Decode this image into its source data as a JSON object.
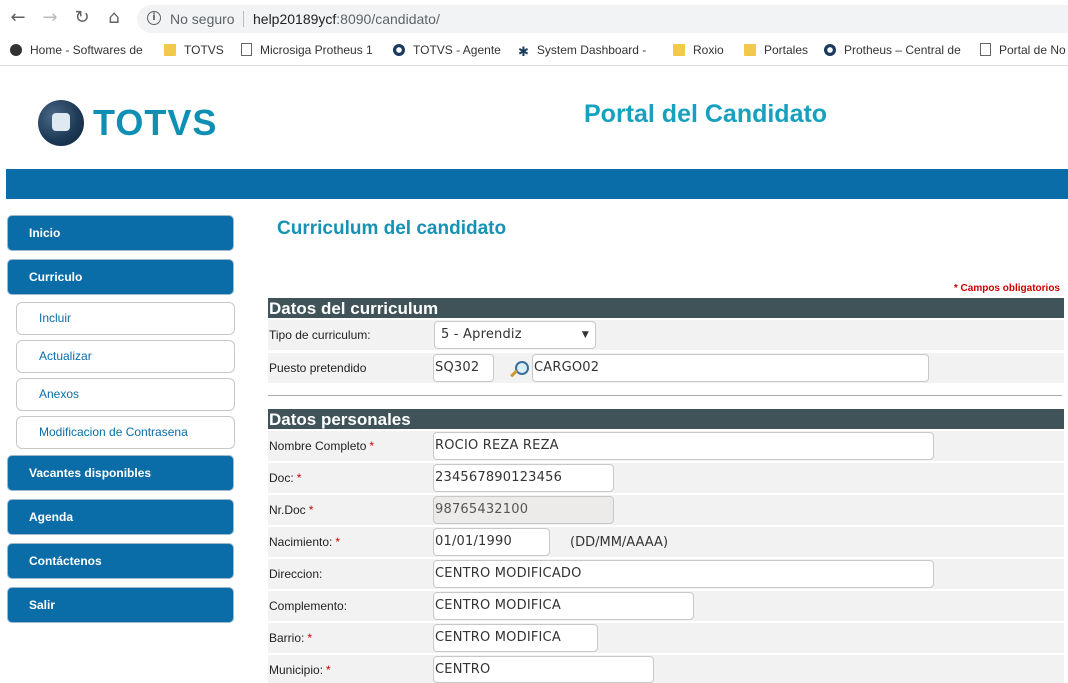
{
  "browser": {
    "security_label": "No seguro",
    "url_host": "help20189ycf",
    "url_rest": ":8090/candidato/",
    "bookmarks": [
      {
        "label": "Home - Softwares de",
        "icon": "globe-icon"
      },
      {
        "label": "TOTVS",
        "icon": "folder-icon"
      },
      {
        "label": "Microsiga Protheus 1",
        "icon": "page-icon"
      },
      {
        "label": "TOTVS - Agente",
        "icon": "totvs-icon"
      },
      {
        "label": "System Dashboard -",
        "icon": "jira-icon"
      },
      {
        "label": "Roxio",
        "icon": "folder-icon"
      },
      {
        "label": "Portales",
        "icon": "folder-icon"
      },
      {
        "label": "Protheus – Central de",
        "icon": "totvs-icon"
      },
      {
        "label": "Portal de No",
        "icon": "page-icon"
      }
    ]
  },
  "header": {
    "logo_text": "TOTVS",
    "portal_title": "Portal del Candidato"
  },
  "sidebar": {
    "items": [
      {
        "label": "Inicio"
      },
      {
        "label": "Curriculo"
      },
      {
        "label": "Incluir"
      },
      {
        "label": "Actualizar"
      },
      {
        "label": "Anexos"
      },
      {
        "label": "Modificacion de Contrasena"
      },
      {
        "label": "Vacantes disponibles"
      },
      {
        "label": "Agenda"
      },
      {
        "label": "Contáctenos"
      },
      {
        "label": "Salir"
      }
    ]
  },
  "main": {
    "title": "Curriculum del candidato",
    "required_note": "* Campos obligatorios",
    "section_curriculum": "Datos del curriculum",
    "section_personal": "Datos personales",
    "fields": {
      "tipo_label": "Tipo de curriculum:",
      "tipo_value": "5 - Aprendiz",
      "puesto_label": "Puesto pretendido",
      "puesto_code": "SQ302",
      "puesto_desc": "CARGO02",
      "nombre_label": "Nombre Completo",
      "nombre_value": "ROCIO REZA REZA",
      "doc_label": "Doc:",
      "doc_value": "234567890123456",
      "nrdoc_label": "Nr.Doc",
      "nrdoc_value": "98765432100",
      "nacimiento_label": "Nacimiento:",
      "nacimiento_value": "01/01/1990",
      "nacimiento_hint": "(DD/MM/AAAA)",
      "direccion_label": "Direccion:",
      "direccion_value": "CENTRO MODIFICADO",
      "complemento_label": "Complemento:",
      "complemento_value": "CENTRO MODIFICA",
      "barrio_label": "Barrio:",
      "barrio_value": "CENTRO MODIFICA",
      "municipio_label": "Municipio:",
      "municipio_value": "CENTRO"
    },
    "required_mark": "*"
  },
  "colors": {
    "brand_blue": "#0b6da8",
    "title_teal": "#15a1bf",
    "section_header": "#3f5358",
    "required_red": "#cc0000"
  }
}
